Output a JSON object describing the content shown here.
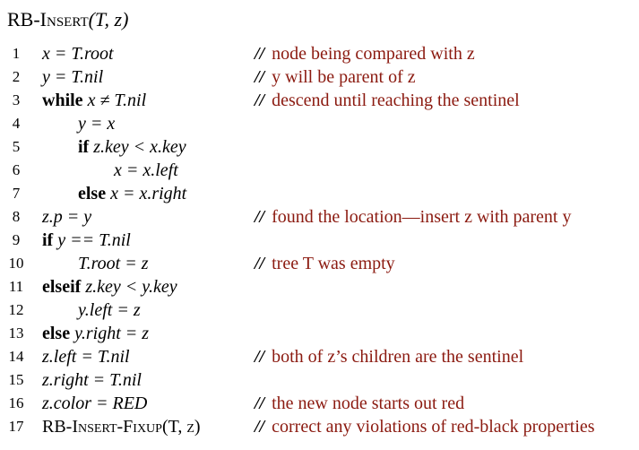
{
  "title": {
    "name": "RB-Insert",
    "args": "(T, z)"
  },
  "comment_marker": "//",
  "lines": [
    {
      "num": "1",
      "indent": 0,
      "code": "x = T.root",
      "comment": "node being compared with z"
    },
    {
      "num": "2",
      "indent": 0,
      "code": "y = T.nil",
      "comment": "y will be parent of z"
    },
    {
      "num": "3",
      "indent": 0,
      "keyword": "while",
      "code": "x ≠ T.nil",
      "comment": "descend until reaching the sentinel"
    },
    {
      "num": "4",
      "indent": 1,
      "code": "y = x",
      "comment": ""
    },
    {
      "num": "5",
      "indent": 1,
      "keyword": "if",
      "code": "z.key < x.key",
      "comment": ""
    },
    {
      "num": "6",
      "indent": 2,
      "code": "x = x.left",
      "comment": ""
    },
    {
      "num": "7",
      "indent": 1,
      "keyword": "else",
      "code": "x = x.right",
      "comment": ""
    },
    {
      "num": "8",
      "indent": 0,
      "code": "z.p = y",
      "comment": "found the location—insert z with parent y"
    },
    {
      "num": "9",
      "indent": 0,
      "keyword": "if",
      "code": "y == T.nil",
      "comment": ""
    },
    {
      "num": "10",
      "indent": 1,
      "code": "T.root = z",
      "comment": "tree T was empty"
    },
    {
      "num": "11",
      "indent": 0,
      "keyword": "elseif",
      "code": "z.key < y.key",
      "comment": ""
    },
    {
      "num": "12",
      "indent": 1,
      "code": "y.left = z",
      "comment": ""
    },
    {
      "num": "13",
      "indent": 0,
      "keyword": "else",
      "code": "y.right = z",
      "comment": ""
    },
    {
      "num": "14",
      "indent": 0,
      "code": "z.left = T.nil",
      "comment": "both of z’s children are the sentinel"
    },
    {
      "num": "15",
      "indent": 0,
      "code": "z.right = T.nil",
      "comment": ""
    },
    {
      "num": "16",
      "indent": 0,
      "code": "z.color = RED",
      "comment": "the new node starts out red"
    },
    {
      "num": "17",
      "indent": 0,
      "code": "RB-Insert-Fixup(T, z)",
      "comment": "correct any violations of red-black properties"
    }
  ]
}
